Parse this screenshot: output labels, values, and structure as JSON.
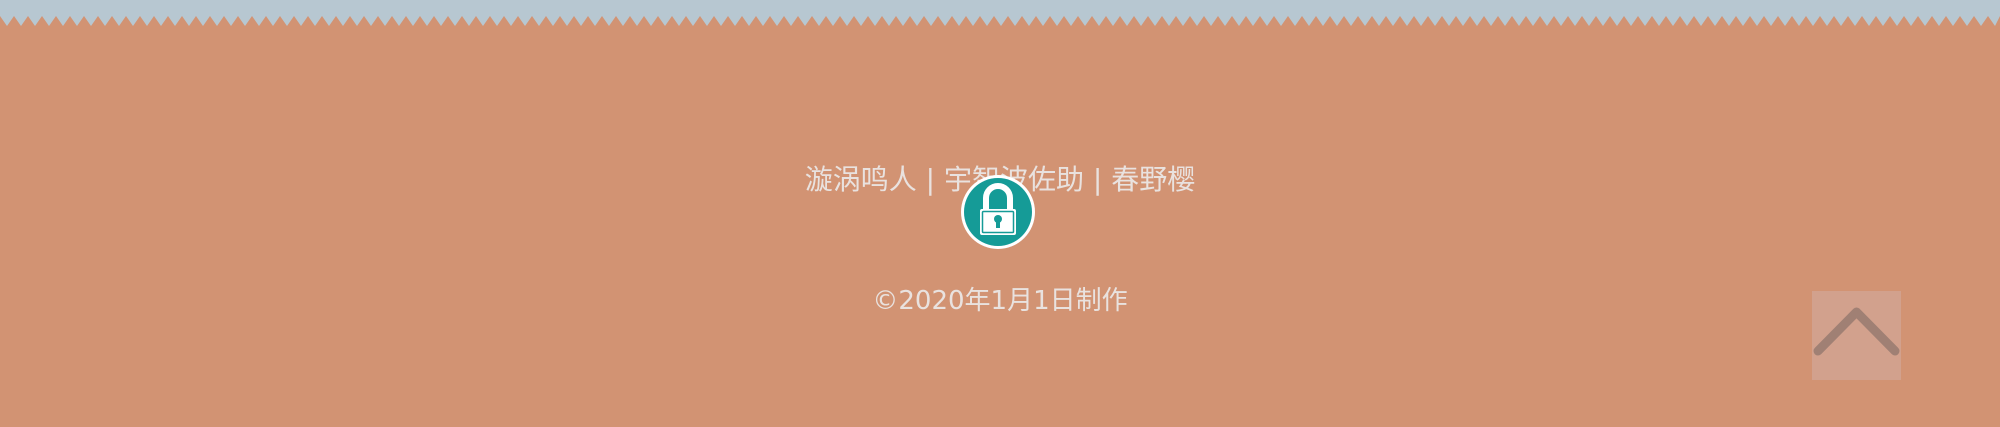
{
  "footer": {
    "names": "漩涡鸣人 | 宇智波佐助 | 春野樱",
    "copyright": "©2020年1月1日制作"
  },
  "icons": {
    "lock": "lock-icon",
    "back_to_top": "chevron-up-icon"
  },
  "colors": {
    "background": "#d29373",
    "zigzag_top": "#b7c7d1",
    "text": "#e9e2df",
    "lock_teal": "#159b97",
    "back_top_bg": "#d1a593",
    "chevron": "#a08074"
  }
}
